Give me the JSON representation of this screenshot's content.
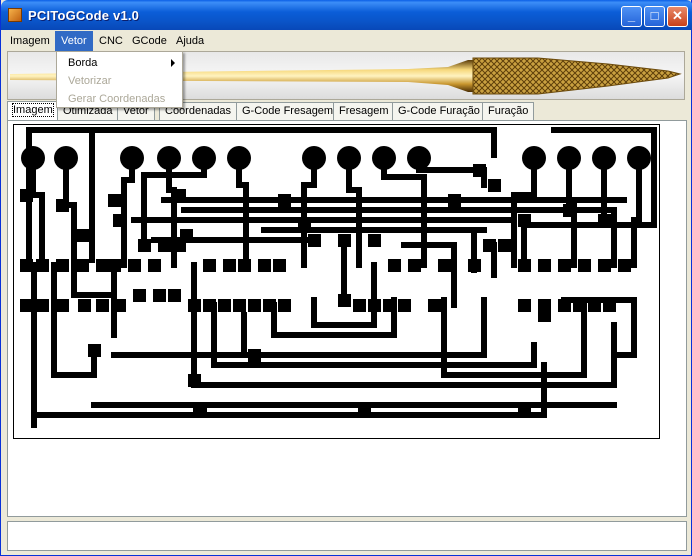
{
  "window": {
    "title": "PCIToGCode  v1.0",
    "app_icon": "app-icon",
    "controls": {
      "minimize": "_",
      "maximize": "□",
      "close": "✕"
    }
  },
  "menubar": {
    "items": [
      {
        "label": "Imagem"
      },
      {
        "label": "Vetor"
      },
      {
        "label": "CNC"
      },
      {
        "label": "GCode"
      },
      {
        "label": "Ajuda"
      }
    ],
    "active": "Vetor"
  },
  "vetor_menu": {
    "items": [
      {
        "label": "Borda",
        "enabled": true,
        "has_submenu": true
      },
      {
        "label": "Vetorizar",
        "enabled": false
      },
      {
        "label": "Gerar Coordenadas",
        "enabled": false
      }
    ]
  },
  "banner": {
    "image": "drill-bit-image"
  },
  "tabs": {
    "items": [
      {
        "label": "Imagem"
      },
      {
        "label": "Otimizada"
      },
      {
        "label": "Vetor"
      },
      {
        "label": "Coordenadas"
      },
      {
        "label": "G-Code Fresagem"
      },
      {
        "label": "Fresagem"
      },
      {
        "label": "G-Code Furação"
      },
      {
        "label": "Furação"
      }
    ],
    "selected": "Imagem"
  },
  "content": {
    "image": "pcb-layout-image"
  },
  "statusbar": {
    "text": ""
  },
  "colors": {
    "titlebar": "#0a55c9",
    "menu_highlight": "#316ac5",
    "pcb_trace": "#000000",
    "background": "#ece9d8"
  }
}
